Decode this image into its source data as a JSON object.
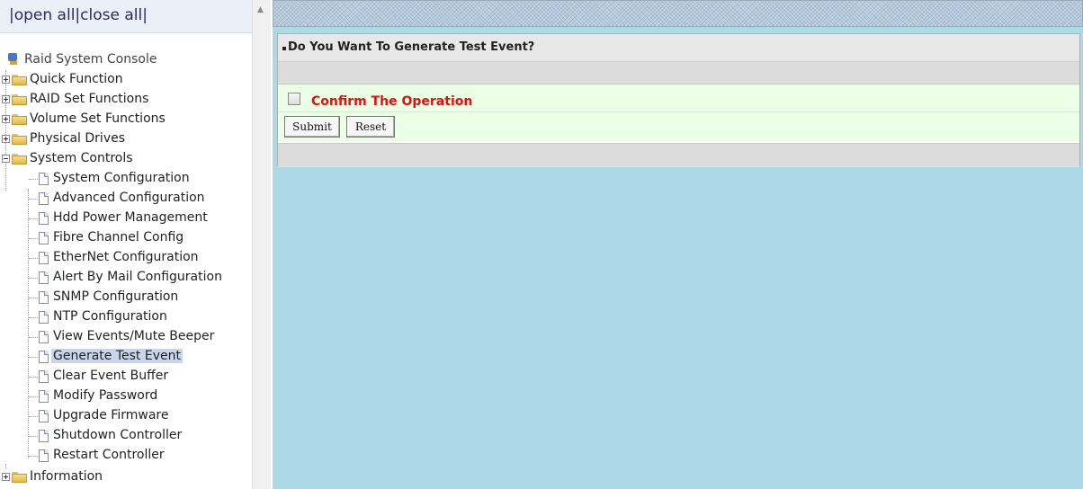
{
  "sidebar": {
    "toplinks": "|open all|close all|",
    "root": "Raid System Console",
    "folders": [
      "Quick Function",
      "RAID Set Functions",
      "Volume Set Functions",
      "Physical Drives",
      "System Controls",
      "Information"
    ],
    "system_controls_items": [
      "System Configuration",
      "Advanced Configuration",
      "Hdd Power Management",
      "Fibre Channel Config",
      "EtherNet Configuration",
      "Alert By Mail Configuration",
      "SNMP Configuration",
      "NTP Configuration",
      "View Events/Mute Beeper",
      "Generate Test Event",
      "Clear Event Buffer",
      "Modify Password",
      "Upgrade Firmware",
      "Shutdown Controller",
      "Restart Controller"
    ],
    "selected": "Generate Test Event"
  },
  "form": {
    "title": "Do You Want To Generate Test Event?",
    "confirm_label": "Confirm The Operation",
    "confirm_checked": false,
    "submit_label": "Submit",
    "reset_label": "Reset"
  },
  "colors": {
    "content_bg": "#add8e6",
    "confirm_text": "#e01010",
    "form_green": "#eaffe6"
  }
}
